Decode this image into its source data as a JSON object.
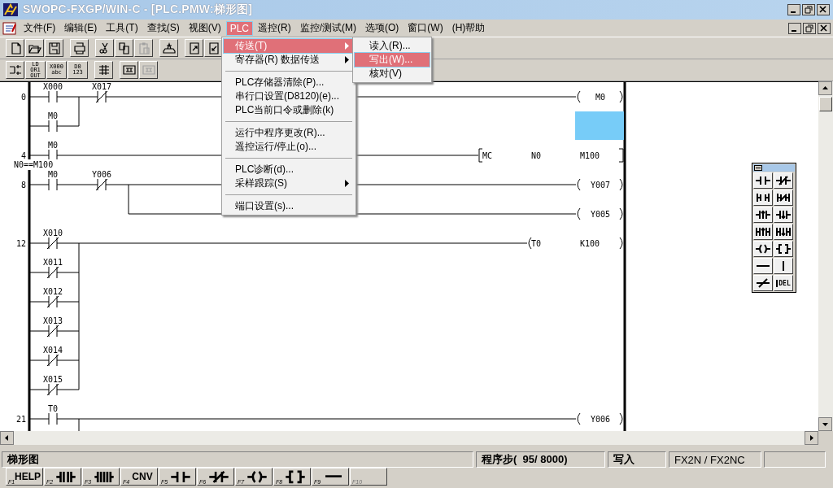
{
  "window": {
    "title": "SWOPC-FXGP/WIN-C - [PLC.PMW:梯形图]"
  },
  "menu_bar": [
    {
      "label": "文件(F)",
      "selected": false
    },
    {
      "label": "编辑(E)",
      "selected": false
    },
    {
      "label": "工具(T)",
      "selected": false
    },
    {
      "label": "查找(S)",
      "selected": false
    },
    {
      "label": "视图(V)",
      "selected": false
    },
    {
      "label": "PLC",
      "selected": true
    },
    {
      "label": "遥控(R)",
      "selected": false
    },
    {
      "label": "监控/测试(M)",
      "selected": false
    },
    {
      "label": "选项(O)",
      "selected": false
    },
    {
      "label": "窗口(W)",
      "selected": false
    },
    {
      "label": "(H)帮助",
      "selected": false
    }
  ],
  "toolbar_1": [
    {
      "kind": "new",
      "disabled": false
    },
    {
      "kind": "open",
      "disabled": false
    },
    {
      "kind": "save",
      "disabled": false
    },
    {
      "kind": "gap"
    },
    {
      "kind": "print",
      "disabled": false
    },
    {
      "kind": "gap"
    },
    {
      "kind": "cut",
      "disabled": false
    },
    {
      "kind": "copy",
      "disabled": false
    },
    {
      "kind": "paste",
      "disabled": true
    },
    {
      "kind": "gap"
    },
    {
      "kind": "transfer",
      "disabled": false
    },
    {
      "kind": "gap"
    },
    {
      "kind": "page-up",
      "disabled": false
    },
    {
      "kind": "page-down",
      "disabled": false
    }
  ],
  "toolbar_2": [
    {
      "kind": "convert",
      "disabled": false
    },
    {
      "kind": "text",
      "lines": [
        "LD",
        "OR1",
        "OUT"
      ],
      "disabled": false
    },
    {
      "kind": "text",
      "lines": [
        "X000",
        "abc"
      ],
      "disabled": false
    },
    {
      "kind": "text",
      "lines": [
        "D0",
        "123"
      ],
      "disabled": false
    },
    {
      "kind": "gap"
    },
    {
      "kind": "grid",
      "disabled": false
    },
    {
      "kind": "gap"
    },
    {
      "kind": "monitor",
      "disabled": false
    },
    {
      "kind": "monitor",
      "disabled": true
    }
  ],
  "ladder": {
    "rungs": [
      {
        "step": "0",
        "contacts": [
          {
            "device": "X000",
            "kind": "no"
          },
          {
            "device": "X017",
            "kind": "nc"
          }
        ],
        "parallel": [
          {
            "device": "M0",
            "kind": "no"
          }
        ],
        "outputs": [
          {
            "kind": "coil",
            "operands": [
              "M0"
            ]
          }
        ],
        "cursor": true
      },
      {
        "step": "4",
        "contacts": [
          {
            "device": "M0",
            "kind": "no"
          }
        ],
        "outputs": [
          {
            "kind": "instruction",
            "operands": [
              "MC",
              "N0",
              "M100"
            ]
          }
        ],
        "cursor": false
      },
      {
        "step": "8",
        "note": "N0==M100",
        "contacts": [
          {
            "device": "M0",
            "kind": "no"
          },
          {
            "device": "Y006",
            "kind": "nc"
          }
        ],
        "outputs": [
          {
            "kind": "coil",
            "operands": [
              "Y007"
            ]
          },
          {
            "kind": "coil",
            "operands": [
              "Y005"
            ]
          }
        ],
        "cursor": false
      },
      {
        "step": "12",
        "contacts": [
          {
            "device": "X010",
            "kind": "nc"
          }
        ],
        "parallel": [
          {
            "device": "X011",
            "kind": "nc"
          },
          {
            "device": "X012",
            "kind": "nc"
          },
          {
            "device": "X013",
            "kind": "nc"
          },
          {
            "device": "X014",
            "kind": "nc"
          },
          {
            "device": "X015",
            "kind": "nc"
          }
        ],
        "outputs": [
          {
            "kind": "coil",
            "operands": [
              "T0",
              "K100"
            ]
          }
        ],
        "cursor": false
      },
      {
        "step": "21",
        "contacts": [
          {
            "device": "T0",
            "kind": "no"
          }
        ],
        "outputs": [
          {
            "kind": "coil",
            "operands": [
              "Y006"
            ]
          }
        ],
        "cursor": false,
        "continues": true
      }
    ]
  },
  "plc_menu": {
    "items": [
      {
        "kind": "item",
        "label": "传送(T)",
        "selected": true,
        "submenu": true
      },
      {
        "kind": "item",
        "label": "寄存器(R) 数据传送",
        "selected": false,
        "submenu": true
      },
      {
        "kind": "separator"
      },
      {
        "kind": "item",
        "label": "PLC存储器清除(P)...",
        "selected": false,
        "submenu": false
      },
      {
        "kind": "item",
        "label": "串行口设置(D8120)(e)...",
        "selected": false,
        "submenu": false
      },
      {
        "kind": "item",
        "label": "PLC当前口令或删除(k)",
        "selected": false,
        "submenu": false
      },
      {
        "kind": "separator"
      },
      {
        "kind": "item",
        "label": "运行中程序更改(R)...",
        "selected": false,
        "submenu": false
      },
      {
        "kind": "item",
        "label": "遥控运行/停止(o)...",
        "selected": false,
        "submenu": false
      },
      {
        "kind": "separator"
      },
      {
        "kind": "item",
        "label": "PLC诊断(d)...",
        "selected": false,
        "submenu": false
      },
      {
        "kind": "item",
        "label": "采样跟踪(S)",
        "selected": false,
        "submenu": true
      },
      {
        "kind": "separator"
      },
      {
        "kind": "item",
        "label": "端口设置(s)...",
        "selected": false,
        "submenu": false
      }
    ]
  },
  "transfer_submenu": {
    "items": [
      {
        "label": "读入(R)...",
        "selected": false
      },
      {
        "label": "写出(W)...",
        "selected": true
      },
      {
        "label": "核对(V)",
        "selected": false
      }
    ]
  },
  "palette": {
    "buttons": [
      {
        "kind": "contact-no"
      },
      {
        "kind": "contact-nc"
      },
      {
        "kind": "parallel-no"
      },
      {
        "kind": "parallel-nc"
      },
      {
        "kind": "pulse-rise"
      },
      {
        "kind": "pulse-fall"
      },
      {
        "kind": "parallel-rise"
      },
      {
        "kind": "parallel-fall"
      },
      {
        "kind": "coil"
      },
      {
        "kind": "instruction"
      },
      {
        "kind": "hline"
      },
      {
        "kind": "vline"
      },
      {
        "kind": "invert"
      },
      {
        "kind": "delete",
        "label": "DEL"
      }
    ]
  },
  "status_bar": {
    "sections": [
      "梯形图",
      "程序步(  95/ 8000)",
      "写入",
      "FX2N / FX2NC"
    ]
  },
  "function_keys": [
    {
      "key": "F1",
      "kind": "text",
      "label": "HELP",
      "disabled": false
    },
    {
      "key": "F2",
      "kind": "series",
      "disabled": false
    },
    {
      "key": "F3",
      "kind": "series-long",
      "disabled": false
    },
    {
      "key": "F4",
      "kind": "text",
      "label": "CNV",
      "disabled": false
    },
    {
      "key": "F5",
      "kind": "contact-open",
      "disabled": false
    },
    {
      "key": "F6",
      "kind": "contact-nc",
      "disabled": false
    },
    {
      "key": "F7",
      "kind": "coil",
      "disabled": false
    },
    {
      "key": "F8",
      "kind": "instruction",
      "disabled": false
    },
    {
      "key": "F9",
      "kind": "hline",
      "disabled": false
    },
    {
      "key": "F10",
      "kind": "blank",
      "disabled": true
    }
  ]
}
